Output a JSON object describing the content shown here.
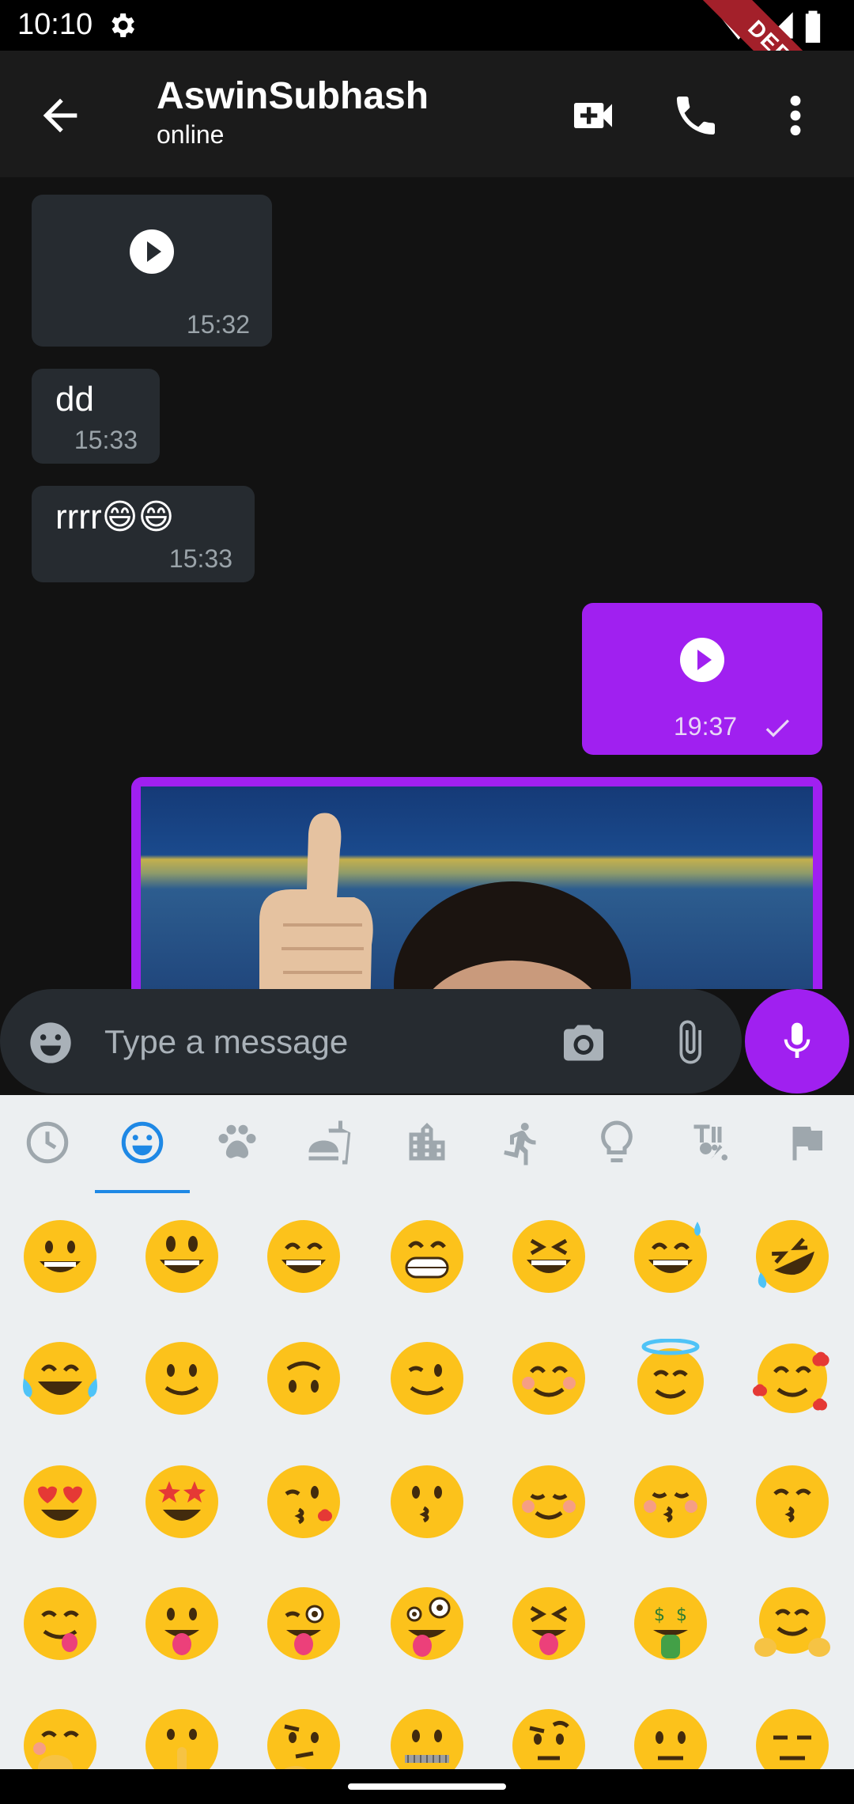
{
  "status_bar": {
    "time": "10:10"
  },
  "debug_ribbon": "DEBUG",
  "app_bar": {
    "contact_name": "AswinSubhash",
    "contact_status": "online"
  },
  "messages": [
    {
      "type": "audio",
      "direction": "incoming",
      "time": "15:32"
    },
    {
      "type": "text",
      "direction": "incoming",
      "text": "dd",
      "time": "15:33"
    },
    {
      "type": "text",
      "direction": "incoming",
      "text": "rrrr😄😄",
      "time": "15:33"
    },
    {
      "type": "audio",
      "direction": "outgoing",
      "time": "19:37",
      "status": "sent"
    },
    {
      "type": "image",
      "direction": "outgoing"
    }
  ],
  "composer": {
    "placeholder": "Type a message"
  },
  "emoji_tabs": [
    "recent",
    "smileys",
    "animals",
    "food",
    "travel",
    "activities",
    "objects",
    "symbols",
    "flags"
  ],
  "emoji_selected_tab": "smileys",
  "emoji_grid": [
    [
      "😀",
      "😃",
      "😄",
      "😁",
      "😆",
      "😅",
      "🤣"
    ],
    [
      "😂",
      "🙂",
      "🙃",
      "😉",
      "😊",
      "😇",
      "🥰"
    ],
    [
      "😍",
      "🤩",
      "😘",
      "😗",
      "☺️",
      "😚",
      "😙"
    ],
    [
      "😋",
      "😛",
      "😜",
      "🤪",
      "😝",
      "🤑",
      "🤗"
    ],
    [
      "🤭",
      "🤫",
      "🤔",
      "🤐",
      "🤨",
      "😐",
      "😑"
    ]
  ],
  "colors": {
    "accent": "#a020f0",
    "incoming_bubble": "#262b30",
    "chat_bg": "#121212",
    "emoji_panel_bg": "#eceff1",
    "tab_indicator": "#1e88e5"
  }
}
